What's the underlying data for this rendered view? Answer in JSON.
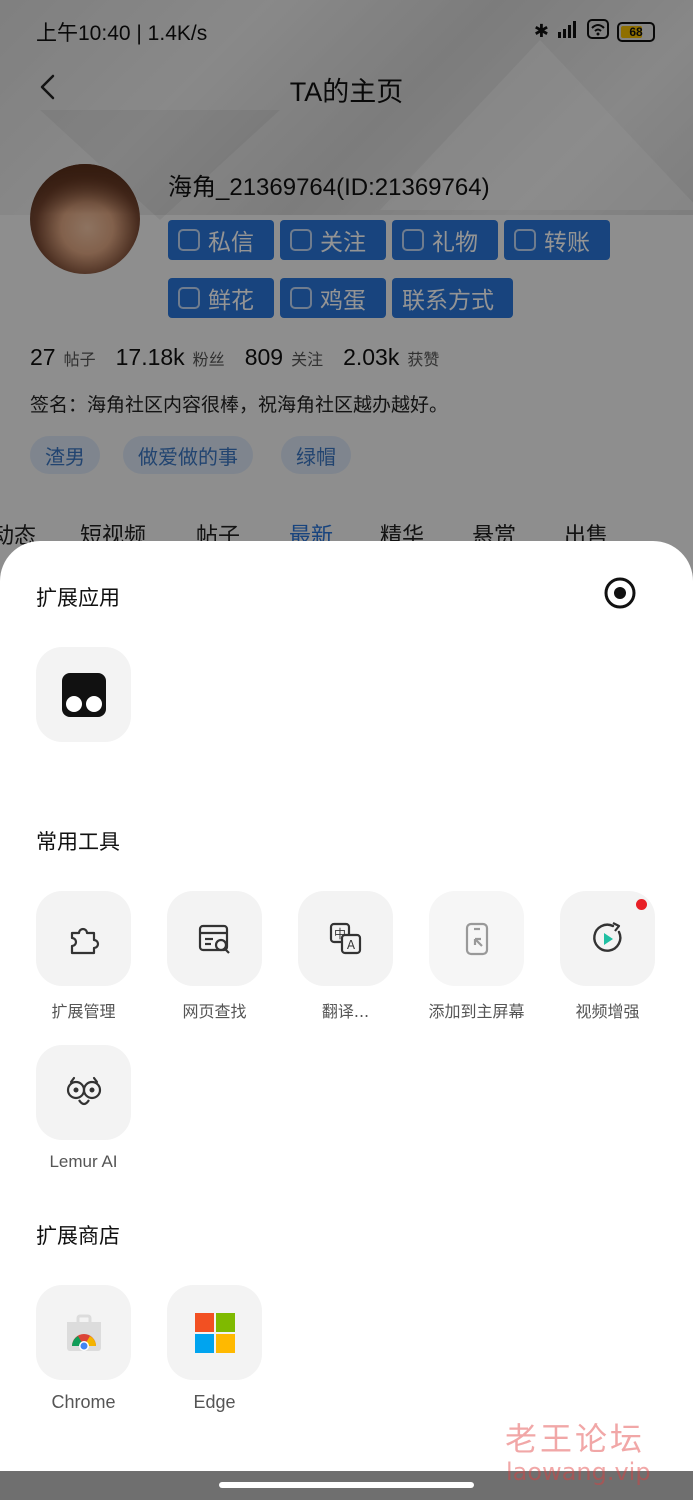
{
  "status_bar": {
    "time": "上午10:40 | 1.4K/s",
    "battery": "68"
  },
  "header": {
    "title": "TA的主页"
  },
  "profile": {
    "username": "海角_21369764(ID:21369764)",
    "actions": [
      "私信",
      "关注",
      "礼物",
      "转账",
      "鲜花",
      "鸡蛋",
      "联系方式"
    ],
    "stats": [
      {
        "value": "27",
        "label": "帖子"
      },
      {
        "value": "17.18k",
        "label": "粉丝"
      },
      {
        "value": "809",
        "label": "关注"
      },
      {
        "value": "2.03k",
        "label": "获赞"
      }
    ],
    "signature": "签名：海角社区内容很棒，祝海角社区越办越好。",
    "tags": [
      "渣男",
      "做爱做的事",
      "绿帽"
    ]
  },
  "tabs": [
    "动态",
    "短视频",
    "帖子",
    "最新",
    "精华",
    "悬赏",
    "出售"
  ],
  "sheet": {
    "extensions_title": "扩展应用",
    "tools_title": "常用工具",
    "tools": [
      {
        "label": "扩展管理",
        "icon": "puzzle-icon"
      },
      {
        "label": "网页查找",
        "icon": "web-search-icon"
      },
      {
        "label": "翻译...",
        "icon": "translate-icon"
      },
      {
        "label": "添加到主屏幕",
        "icon": "add-to-home-icon"
      },
      {
        "label": "视频增强",
        "icon": "video-enhance-icon"
      },
      {
        "label": "Lemur AI",
        "icon": "lemur-ai-icon"
      }
    ],
    "store_title": "扩展商店",
    "stores": [
      {
        "label": "Chrome",
        "icon": "chrome-store-icon"
      },
      {
        "label": "Edge",
        "icon": "edge-store-icon"
      }
    ]
  },
  "watermark": {
    "cn": "老王论坛",
    "en": "laowang.vip"
  },
  "colors": {
    "accent_blue": "#2a76d9",
    "tag_bg": "#dbe6f4",
    "notification_red": "#e81f25"
  }
}
